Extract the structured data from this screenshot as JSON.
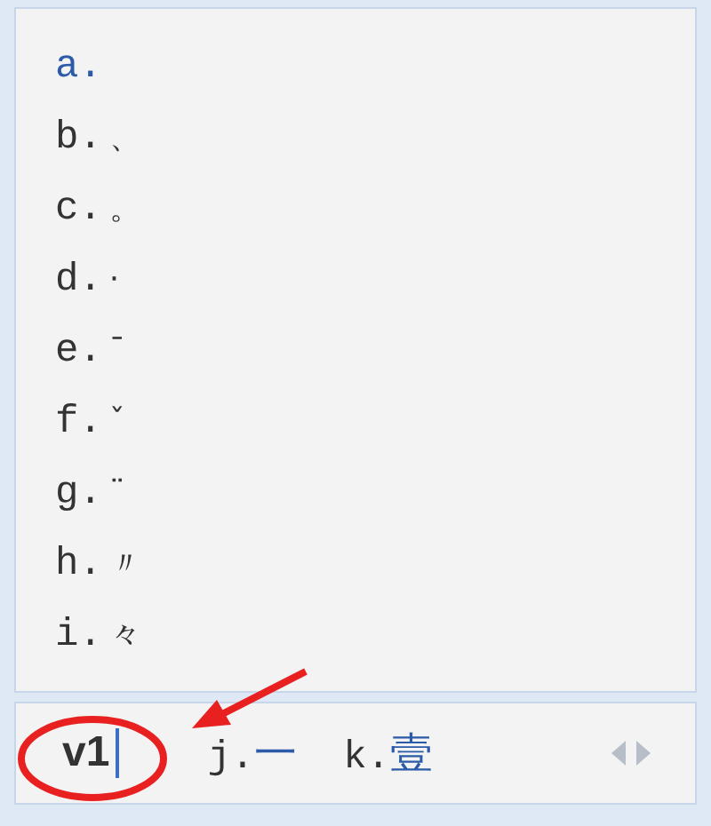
{
  "candidates": [
    {
      "key": "a.",
      "selected": true
    },
    {
      "key": "b.",
      "text": "、",
      "selected": false
    },
    {
      "key": "c.",
      "text": "。",
      "selected": false
    },
    {
      "key": "d.",
      "text": "·",
      "selected": false
    },
    {
      "key": "e.",
      "text": "ˉ",
      "selected": false
    },
    {
      "key": "f.",
      "text": "ˇ",
      "selected": false
    },
    {
      "key": "g.",
      "text": "¨",
      "selected": false
    },
    {
      "key": "h.",
      "text": "〃",
      "selected": false
    },
    {
      "key": "i.",
      "text": "々",
      "selected": false
    }
  ],
  "composition": {
    "value": "v1"
  },
  "bar_candidates": [
    {
      "key": "j.",
      "text": "一"
    },
    {
      "key": "k.",
      "text": "壹"
    }
  ]
}
